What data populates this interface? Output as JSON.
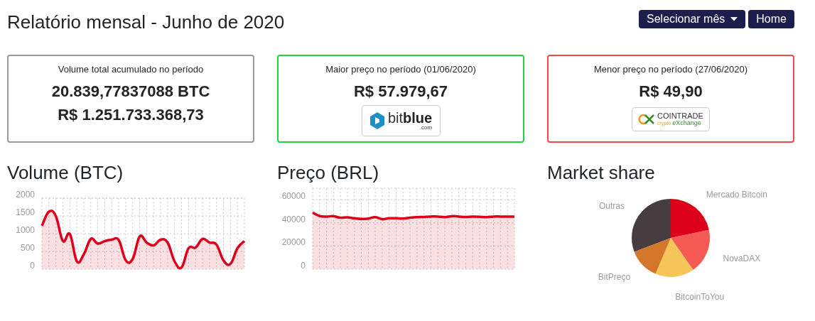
{
  "page_title": "Relatório mensal - Junho de 2020",
  "buttons": [
    {
      "label": "Selecionar mês",
      "kind": "dropdown"
    },
    {
      "label": "Home",
      "kind": "plain"
    }
  ],
  "cards": [
    {
      "color": "#9a9a9a",
      "caption": "Volume total acumulado no período",
      "values": [
        "20.839,77837088 BTC",
        "R$ 1.251.733.368,73"
      ]
    },
    {
      "color": "#22d43c",
      "caption": "Maior preço no período (01/06/2020)",
      "values": [
        "R$ 57.979,67"
      ],
      "logo": {
        "kind": "bitblue",
        "words": [
          "bit",
          "blue",
          ".com"
        ]
      }
    },
    {
      "color": "#f04b4b",
      "caption": "Menor preço no período (27/06/2020)",
      "values": [
        "R$ 49,90"
      ],
      "logo": {
        "kind": "cointrade",
        "words": [
          "COINTRADE",
          "crypto",
          "eXchange"
        ]
      }
    }
  ],
  "charts": [
    {
      "title": "Volume (BTC)",
      "chart_data": {
        "type": "area",
        "grid": true,
        "series": [
          {
            "color": "#dc001a",
            "values": [
              1220,
              1620,
              1490,
              790,
              990,
              220,
              420,
              850,
              720,
              790,
              830,
              820,
              250,
              290,
              920,
              750,
              670,
              830,
              750,
              220,
              50,
              590,
              610,
              850,
              750,
              690,
              250,
              150,
              590,
              790
            ]
          }
        ],
        "ylim": [
          0,
          2000
        ],
        "yticks": [
          0,
          500,
          1000,
          1500,
          2000
        ]
      }
    },
    {
      "title": "Preço (BRL)",
      "chart_data": {
        "type": "area",
        "grid": true,
        "series": [
          {
            "color": "#dc001a",
            "values": [
              49000,
              46000,
              45500,
              45800,
              44500,
              44800,
              44000,
              43500,
              43800,
              45000,
              43200,
              44000,
              44000,
              43800,
              44500,
              45000,
              45200,
              45500,
              45500,
              45000,
              45800,
              45500,
              45200,
              45500,
              45300,
              45000,
              45500,
              45500,
              45500,
              45500
            ]
          }
        ],
        "ylim": [
          0,
          70000
        ],
        "yticks": [
          0,
          20000,
          40000,
          60000
        ]
      }
    },
    {
      "title": "Market share",
      "chart_data": {
        "type": "pie",
        "categories": [
          "Mercado Bitcoin",
          "NovaDAX",
          "BitcoinToYou",
          "BitPreço",
          "Outras"
        ],
        "series": [
          {
            "values": [
              21.7,
              18.6,
              16.1,
              12.8,
              30.8
            ]
          }
        ],
        "colors": [
          "#dc001a",
          "#f55a55",
          "#f5c55a",
          "#d5772a",
          "#473c40"
        ]
      }
    }
  ]
}
